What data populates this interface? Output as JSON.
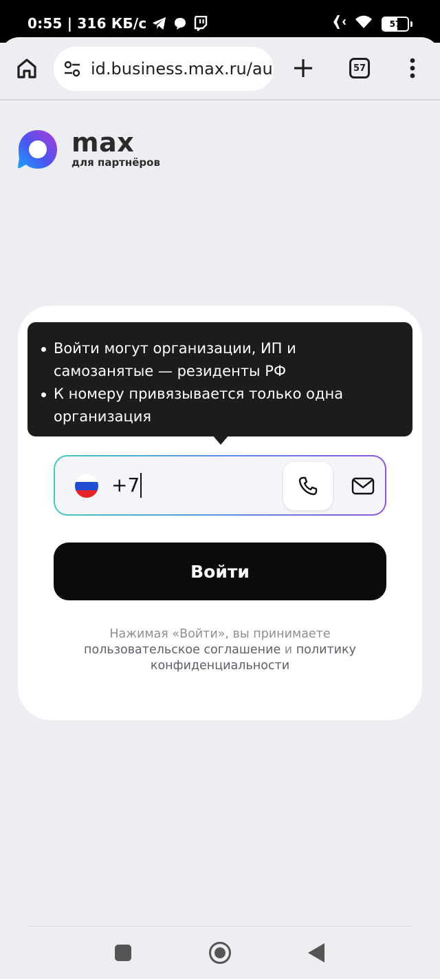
{
  "status_bar": {
    "time_speed": "0:55 | 316 КБ/с",
    "battery_level": "57",
    "battery_fraction": 0.57
  },
  "browser": {
    "url": "id.business.max.ru/au",
    "tab_count": "57"
  },
  "logo": {
    "name": "max",
    "subtitle": "для партнёров"
  },
  "tooltip": {
    "items": [
      "Войти могут организации, ИП и самозанятые — резиденты РФ",
      "К номеру привязывается только одна организация"
    ]
  },
  "phone_field": {
    "value": "+7",
    "flag_colors": [
      "#ffffff",
      "#1f4fd0",
      "#e3242b"
    ]
  },
  "submit": {
    "label": "Войти"
  },
  "legal": {
    "prefix": "Нажимая «Войти», вы принимаете ",
    "agreement_link": "пользовательское соглашение",
    "conjunction": " и ",
    "privacy_link": "политику конфиденциальности"
  },
  "icons": {
    "status": [
      "telegram-icon",
      "chat-bubble-icon",
      "twitch-icon",
      "airplane-icon",
      "wifi-icon",
      "battery-icon"
    ],
    "toolbar": [
      "home-icon",
      "tune-icon",
      "plus-icon",
      "tabs-icon",
      "more-vert-icon"
    ],
    "field": [
      "phone-icon",
      "mail-icon"
    ],
    "nav": [
      "recents-icon",
      "home-nav-icon",
      "back-icon"
    ]
  }
}
